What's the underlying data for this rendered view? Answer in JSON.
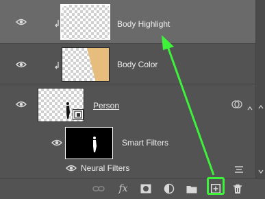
{
  "layers": [
    {
      "name": "Body Highlight",
      "selected": true,
      "clipped": true
    },
    {
      "name": "Body Color",
      "selected": false,
      "clipped": true
    },
    {
      "name": "Person",
      "selected": false,
      "clipped": false,
      "smart_object": true
    },
    {
      "name": "Smart Filters",
      "selected": false,
      "clipped": false
    },
    {
      "name": "Neural Filters",
      "selected": false,
      "clipped": false
    }
  ],
  "toolbar": {
    "buttons": [
      "link-layers",
      "add-layer-style",
      "add-layer-mask",
      "new-fill-adjustment-layer",
      "new-group",
      "create-new-layer",
      "delete-layer"
    ],
    "fx_label": "fx",
    "highlighted": "create-new-layer"
  },
  "colors": {
    "panel_bg": "#535353",
    "selected_row": "#6a6a6a",
    "annotation_green": "#3ef23a",
    "skin_tan": "#e7bd7e"
  }
}
